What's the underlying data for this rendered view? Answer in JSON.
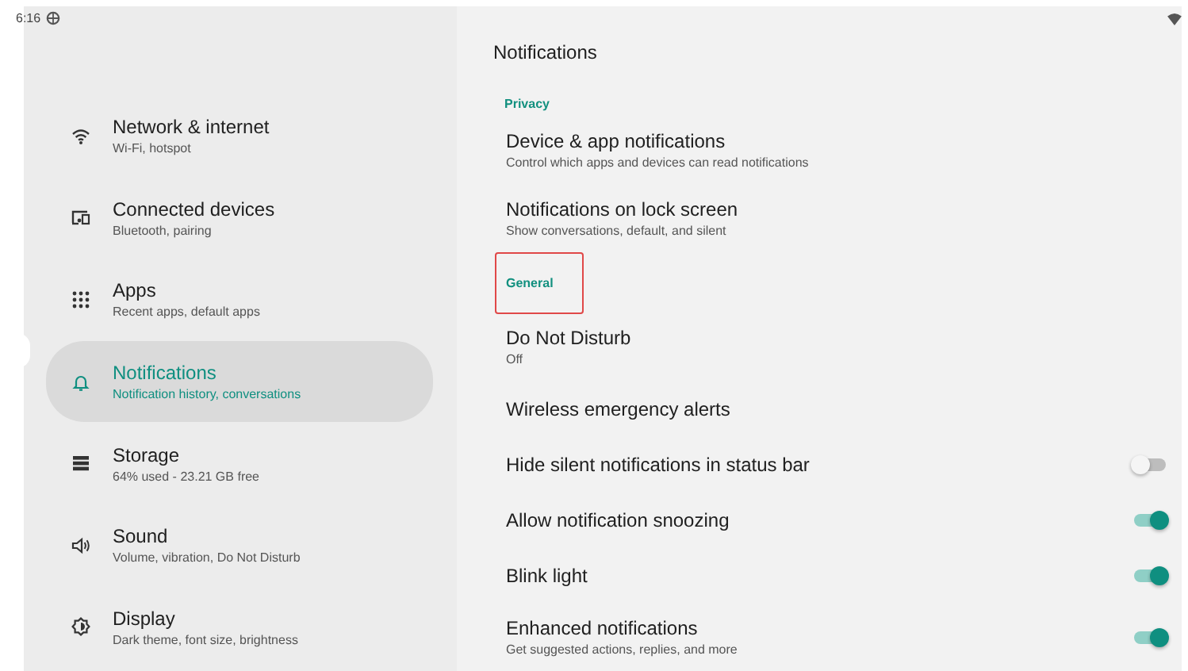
{
  "status_bar": {
    "time": "6:16"
  },
  "sidebar": {
    "items": [
      {
        "title": "Network & internet",
        "subtitle": "Wi-Fi, hotspot",
        "selected": false
      },
      {
        "title": "Connected devices",
        "subtitle": "Bluetooth, pairing",
        "selected": false
      },
      {
        "title": "Apps",
        "subtitle": "Recent apps, default apps",
        "selected": false
      },
      {
        "title": "Notifications",
        "subtitle": "Notification history, conversations",
        "selected": true
      },
      {
        "title": "Storage",
        "subtitle": "64% used - 23.21 GB free",
        "selected": false
      },
      {
        "title": "Sound",
        "subtitle": "Volume, vibration, Do Not Disturb",
        "selected": false
      },
      {
        "title": "Display",
        "subtitle": "Dark theme, font size, brightness",
        "selected": false
      }
    ]
  },
  "page": {
    "title": "Notifications",
    "rows": [
      {
        "kind": "header",
        "title": "Privacy",
        "highlighted": false
      },
      {
        "kind": "item",
        "title": "Device & app notifications",
        "subtitle": "Control which apps and devices can read notifications"
      },
      {
        "kind": "item",
        "title": "Notifications on lock screen",
        "subtitle": "Show conversations, default, and silent"
      },
      {
        "kind": "header",
        "title": "General",
        "highlighted": true
      },
      {
        "kind": "item",
        "title": "Do Not Disturb",
        "subtitle": "Off"
      },
      {
        "kind": "item",
        "title": "Wireless emergency alerts"
      },
      {
        "kind": "switch",
        "title": "Hide silent notifications in status bar",
        "on": false
      },
      {
        "kind": "switch",
        "title": "Allow notification snoozing",
        "on": true
      },
      {
        "kind": "switch",
        "title": "Blink light",
        "on": true
      },
      {
        "kind": "switch",
        "title": "Enhanced notifications",
        "subtitle": "Get suggested actions, replies, and more",
        "on": true
      }
    ]
  }
}
